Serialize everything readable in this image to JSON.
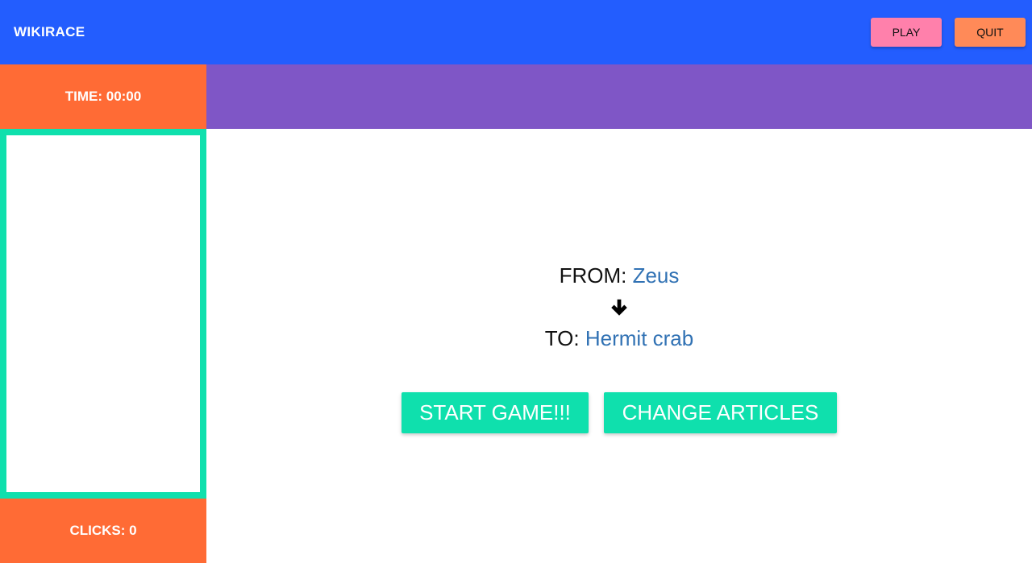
{
  "header": {
    "title": "WIKIRACE",
    "play_label": "PLAY",
    "quit_label": "QUIT"
  },
  "sidebar": {
    "time_label": "TIME: 00:00",
    "clicks_label": "CLICKS: 0"
  },
  "route": {
    "from_label": "FROM:",
    "from_article": "Zeus",
    "to_label": "TO:",
    "to_article": "Hermit crab",
    "arrow_icon": "arrow-down-icon"
  },
  "actions": {
    "start_label": "START GAME!!!",
    "change_label": "CHANGE ARTICLES"
  },
  "colors": {
    "header_bg": "#235dfe",
    "sidebar_orange": "#ff6b35",
    "panel_border": "#0fe0ad",
    "strip_purple": "#7f56c6",
    "play_pink": "#ff80ab",
    "quit_orange": "#ff8a58",
    "link_blue": "#3172b4",
    "button_teal": "#0fe0ad"
  }
}
